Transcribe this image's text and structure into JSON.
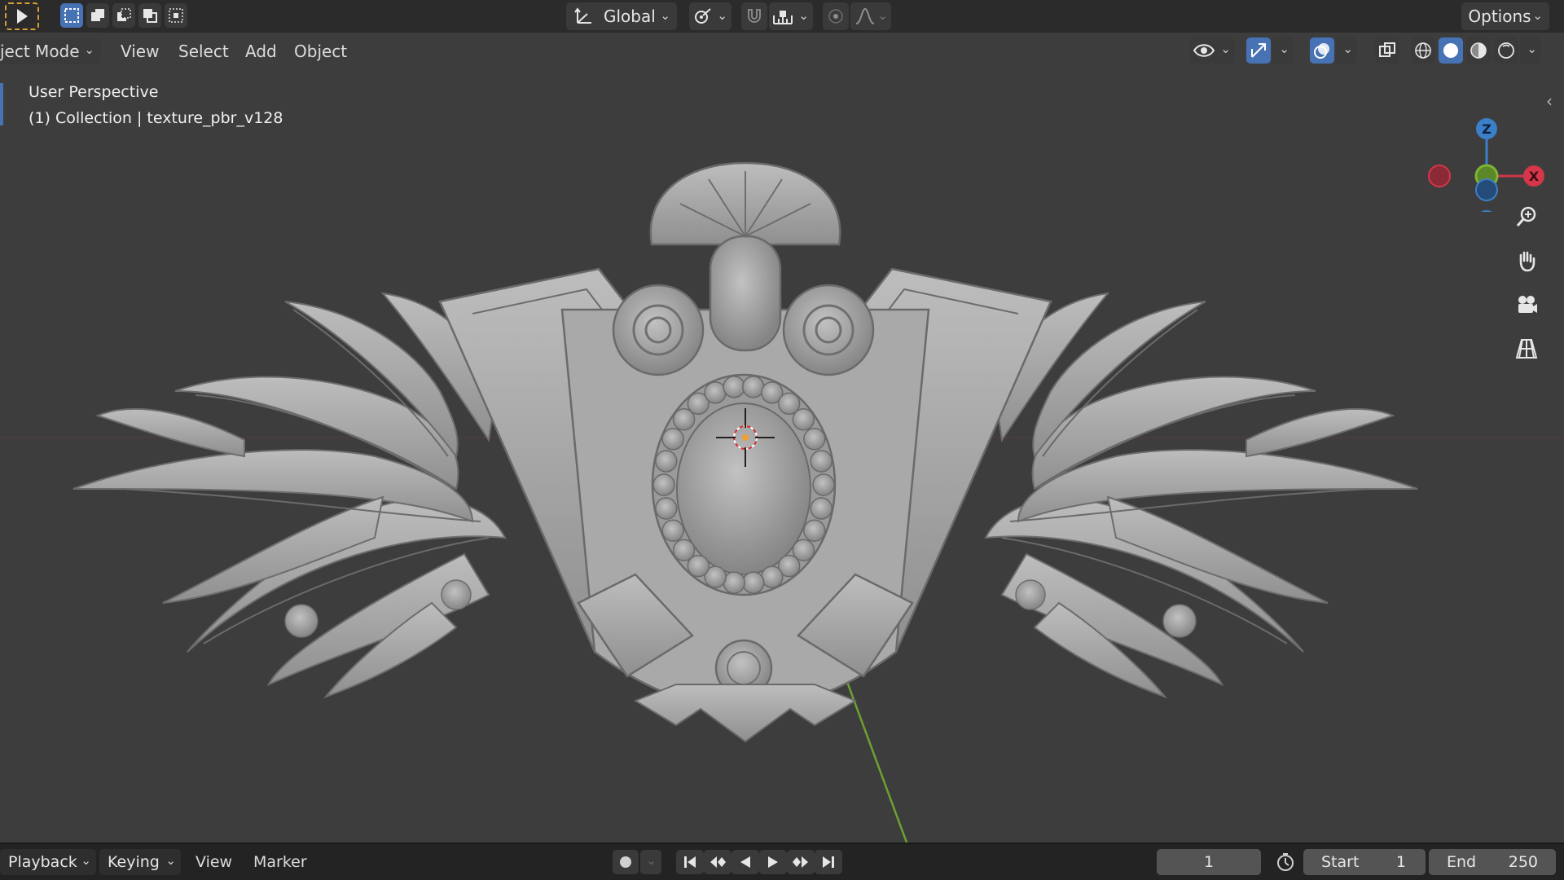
{
  "header": {
    "orientation_label": "Global",
    "options_label": "Options"
  },
  "menu": {
    "mode_label": "ject Mode",
    "items": [
      "View",
      "Select",
      "Add",
      "Object"
    ]
  },
  "viewport": {
    "perspective_label": "User Perspective",
    "collection_label": "(1) Collection | texture_pbr_v128",
    "gizmo_axes": {
      "x": "X",
      "z": "Z"
    }
  },
  "timeline": {
    "menus": [
      "Playback",
      "Keying",
      "View",
      "Marker"
    ],
    "current_frame": "1",
    "start_label": "Start",
    "start_value": "1",
    "end_label": "End",
    "end_value": "250"
  },
  "colors": {
    "x_axis": "#d4364a",
    "y_axis": "#7fb335",
    "z_axis": "#3b7fc9",
    "active_blue": "#4772b3"
  }
}
